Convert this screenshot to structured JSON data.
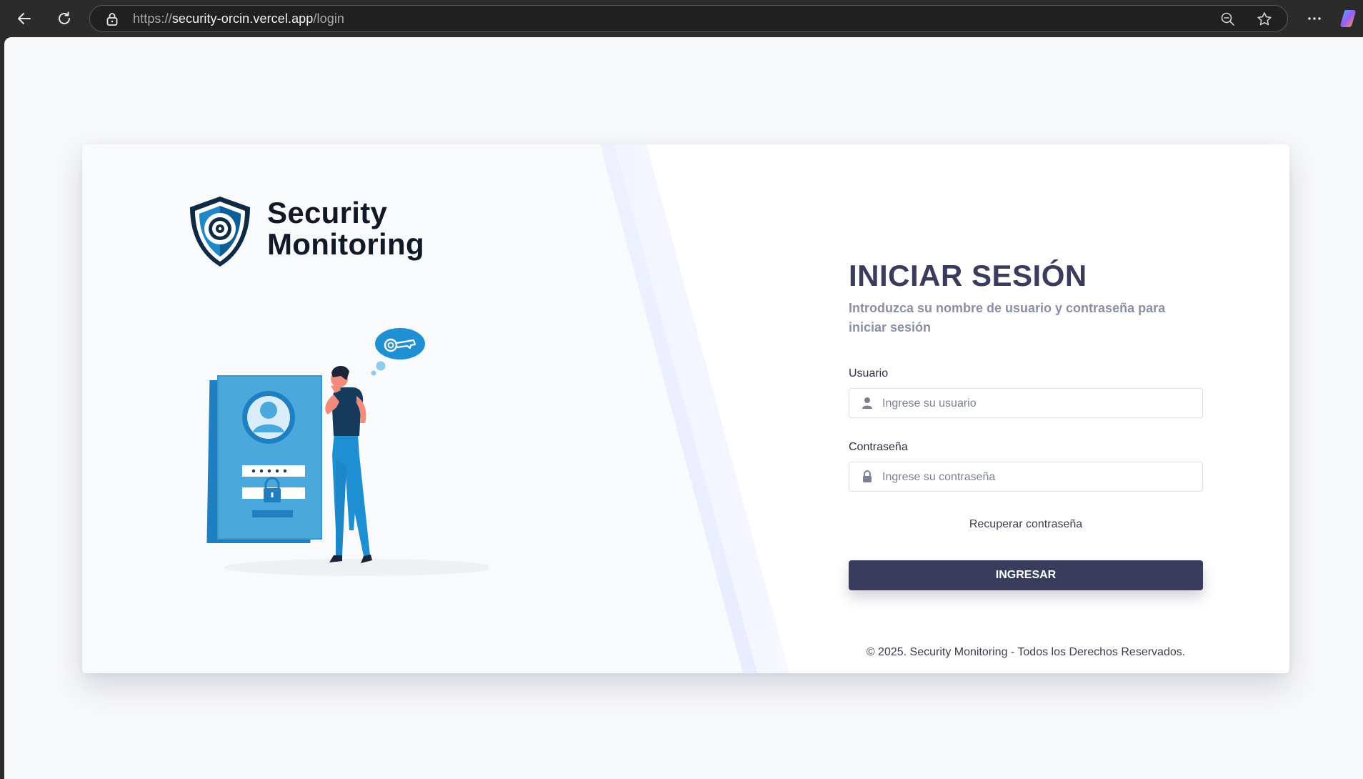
{
  "browser": {
    "url_scheme": "https://",
    "url_host": "security-orcin.vercel.app",
    "url_path": "/login",
    "icons": [
      "back-icon",
      "refresh-icon",
      "lock-icon",
      "zoom-out-icon",
      "star-icon",
      "more-icon",
      "copilot-icon"
    ]
  },
  "brand": {
    "line1": "Security",
    "line2": "Monitoring"
  },
  "form": {
    "title": "INICIAR SESIÓN",
    "subtitle": "Introduzca su nombre de usuario y contraseña para iniciar sesión",
    "username": {
      "label": "Usuario",
      "placeholder": "Ingrese su usuario",
      "value": ""
    },
    "password": {
      "label": "Contraseña",
      "placeholder": "Ingrese su contraseña",
      "value": ""
    },
    "forgot_link": "Recuperar contraseña",
    "submit_label": "INGRESAR"
  },
  "footer": {
    "text": "© 2025. Security Monitoring - Todos los Derechos Reservados."
  },
  "colors": {
    "primary": "#393c5c",
    "accent_blue": "#2f9fd8",
    "subtitle": "#8a8fa8",
    "background": "#f7f8fa"
  }
}
